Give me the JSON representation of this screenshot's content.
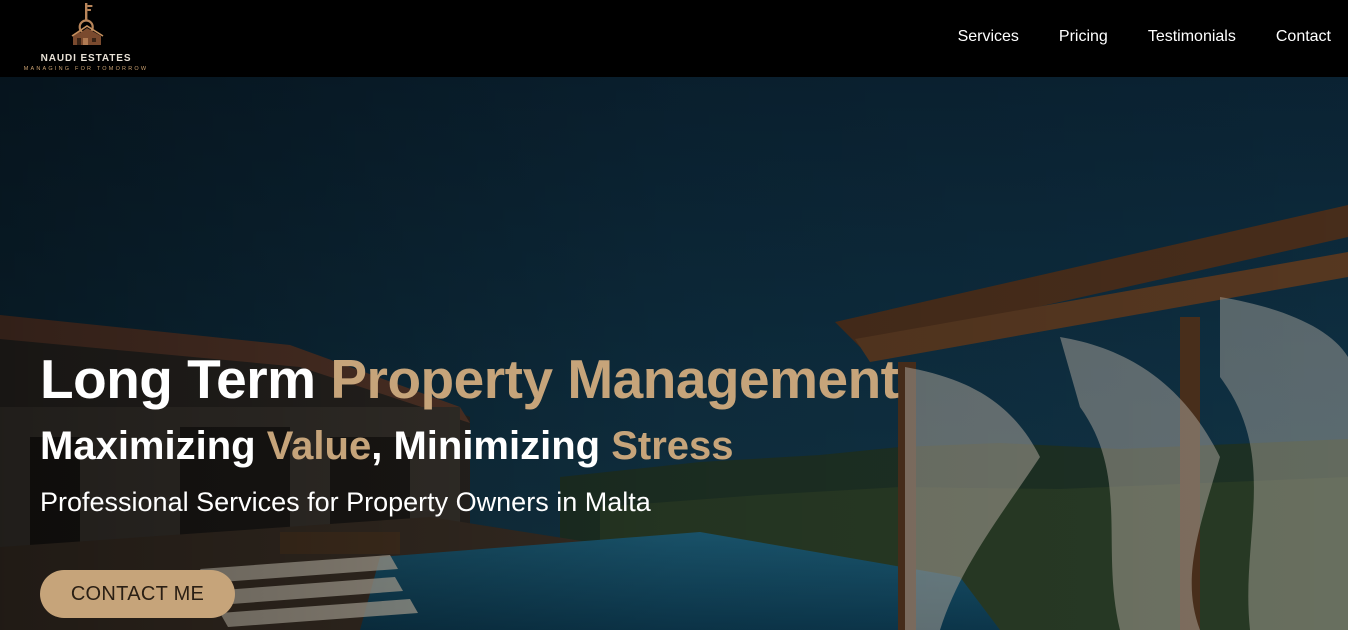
{
  "brand": {
    "name": "NAUDI ESTATES",
    "tagline": "MANAGING FOR TOMORROW"
  },
  "nav": {
    "items": [
      {
        "label": "Services"
      },
      {
        "label": "Pricing"
      },
      {
        "label": "Testimonials"
      },
      {
        "label": "Contact"
      }
    ]
  },
  "hero": {
    "title_plain": "Long Term ",
    "title_accent": "Property Management",
    "subtitle_part1": "Maximizing ",
    "subtitle_accent1": "Value",
    "subtitle_part2": ", Minimizing ",
    "subtitle_accent2": "Stress",
    "tagline": "Professional Services for Property Owners in Malta",
    "cta_label": "CONTACT ME"
  },
  "colors": {
    "accent": "#c6a47a",
    "header_bg": "#000000",
    "sky": "#0d2c3f"
  }
}
